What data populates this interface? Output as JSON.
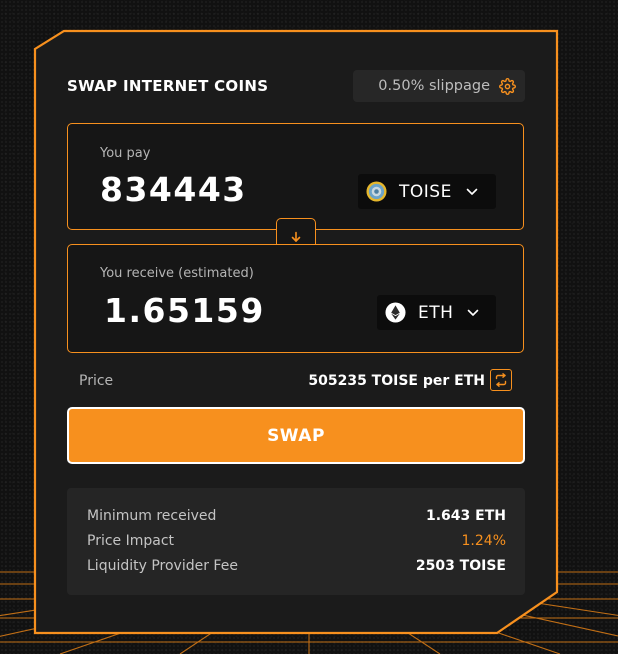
{
  "swap_card": {
    "title": "SWAP INTERNET COINS",
    "slippage": "0.50% slippage",
    "pay": {
      "label": "You pay",
      "amount": "834443",
      "token": "TOISE"
    },
    "receive": {
      "label": "You receive (estimated)",
      "amount": "1.65159",
      "token": "ETH"
    },
    "price": {
      "label": "Price",
      "value": "505235 TOISE per ETH"
    },
    "swap_button": "SWAP",
    "details": [
      {
        "label": "Minimum received",
        "value": "1.643 ETH"
      },
      {
        "label": "Price Impact",
        "value": "1.24%"
      },
      {
        "label": "Liquidity Provider Fee",
        "value": "2503 TOISE"
      }
    ]
  },
  "icons": {
    "settings": "gear-icon",
    "dropdown": "chevron-down-icon",
    "flip": "arrow-down-icon",
    "invert_price": "swap-arrows-icon",
    "pay_token": "toise-token-icon",
    "receive_token": "eth-token-icon"
  },
  "colors": {
    "accent": "#f7901e",
    "background": "#111111",
    "card": "#1b1b1b",
    "price_impact": "#f7901e"
  }
}
